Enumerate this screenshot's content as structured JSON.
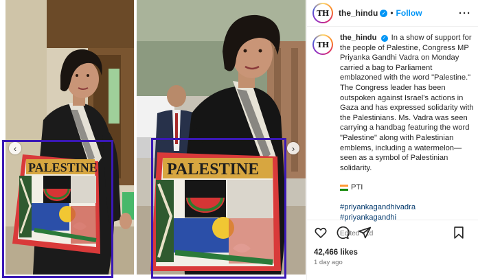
{
  "account": {
    "username": "the_hindu",
    "avatar_text": "TH",
    "follow_label": "Follow",
    "separator": "•"
  },
  "caption": {
    "text": "In a show of support for the people of Palestine, Congress MP Priyanka Gandhi Vadra on Monday carried a bag to Parliament emblazoned with the word \"Palestine.\" The Congress leader has been outspoken against Israel's actions in Gaza and has expressed solidarity with the Palestinians. Ms. Vadra was seen carrying a handbag featuring the word \"Palestine\" along with Palestinian emblems, including a watermelon—seen as a symbol of Palestinian solidarity.",
    "credit": "PTI",
    "hashtags": [
      "#priyankagandhivadra",
      "#priyankagandhi"
    ],
    "edited": "Edited · 1d"
  },
  "engagement": {
    "likes": "42,466 likes",
    "timestamp": "1 day ago"
  },
  "media": {
    "bag_text": "PALESTINE",
    "prev_icon": "chevron-left-icon",
    "next_icon": "chevron-right-icon",
    "highlight_color": "#3a18b5"
  },
  "icons": [
    "heart-icon",
    "comment-icon",
    "share-icon",
    "bookmark-icon",
    "more-options-icon",
    "verified-icon"
  ],
  "colors": {
    "accent": "#0095f6",
    "hashtag": "#00376b",
    "highlight": "#3a18b5"
  }
}
